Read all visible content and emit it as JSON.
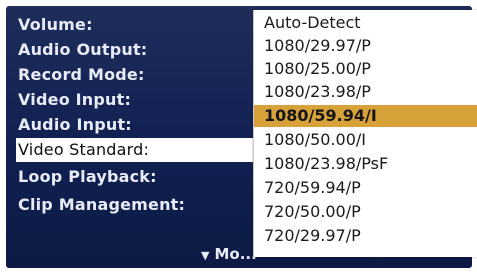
{
  "menu": {
    "items": [
      {
        "label": "Volume:"
      },
      {
        "label": "Audio Output:"
      },
      {
        "label": "Record Mode:"
      },
      {
        "label": "Video Input:"
      },
      {
        "label": "Audio Input:"
      },
      {
        "label": "Video Standard:"
      },
      {
        "label": "Loop Playback:"
      },
      {
        "label": "Clip Management:"
      }
    ],
    "selected_index": 5,
    "more_label": "Mo..."
  },
  "dropdown": {
    "options": [
      {
        "label": "Auto-Detect"
      },
      {
        "label": "1080/29.97/P"
      },
      {
        "label": "1080/25.00/P"
      },
      {
        "label": "1080/23.98/P"
      },
      {
        "label": "1080/59.94/I"
      },
      {
        "label": "1080/50.00/I"
      },
      {
        "label": "1080/23.98/PsF"
      },
      {
        "label": "720/59.94/P"
      },
      {
        "label": "720/50.00/P"
      },
      {
        "label": "720/29.97/P"
      }
    ],
    "highlighted_index": 4,
    "more_dots": "..."
  },
  "colors": {
    "panel_bg": "#112052",
    "highlight": "#d8a23a",
    "menu_text": "#e8ecf6"
  }
}
